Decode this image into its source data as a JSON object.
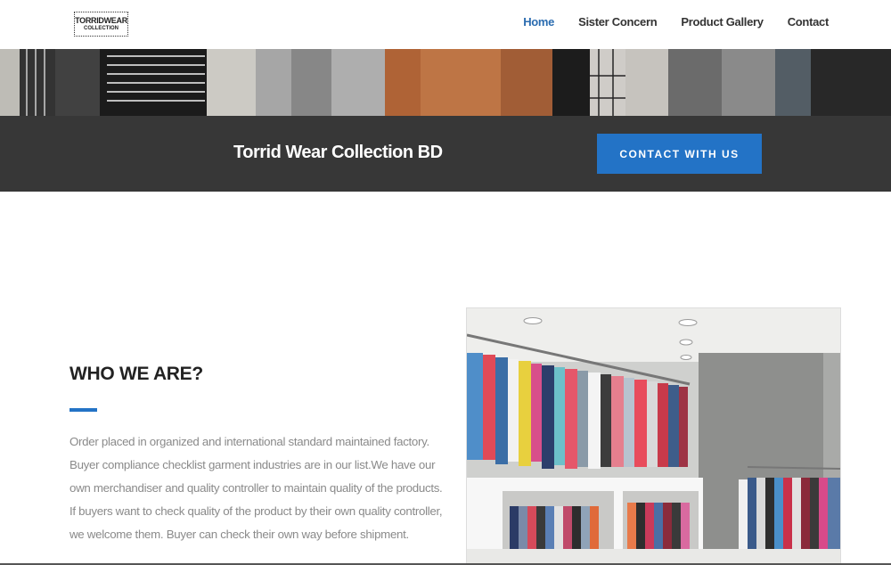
{
  "header": {
    "logo": {
      "line1": "TORRIDWEAR",
      "line2": "COLLECTION"
    },
    "nav": [
      {
        "label": "Home",
        "active": true
      },
      {
        "label": "Sister Concern",
        "active": false
      },
      {
        "label": "Product Gallery",
        "active": false
      },
      {
        "label": "Contact",
        "active": false
      }
    ]
  },
  "cta": {
    "title": "Torrid Wear Collection BD",
    "button_label": "CONTACT WITH US"
  },
  "about": {
    "heading": "WHO WE ARE?",
    "lines": [
      "Order placed in organized and international standard maintained factory.",
      "Buyer compliance checklist garment industries are in our list.We have our",
      "own merchandiser and quality controller to maintain quality of the products.",
      "If buyers want to check quality of the product by their own quality controller,",
      "we welcome them. Buyer can check their own way before shipment."
    ]
  },
  "colors": {
    "accent": "#2373c6",
    "nav_active": "#2b6cb0",
    "cta_bar": "#373737",
    "body_text": "#8a8a8a"
  }
}
